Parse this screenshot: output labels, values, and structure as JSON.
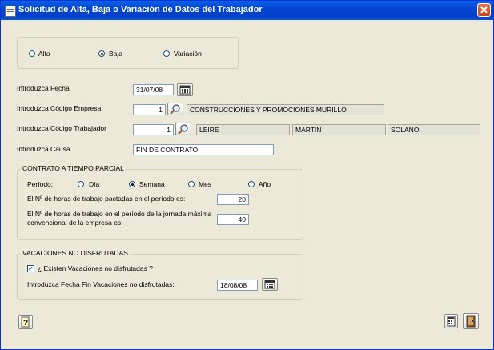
{
  "window": {
    "title": "Solicitud de Alta, Baja o Variación de Datos del Trabajador",
    "close_glyph": "✕"
  },
  "mode": {
    "options": [
      "Alta",
      "Baja",
      "Variación"
    ],
    "selected": "Baja"
  },
  "fecha": {
    "label": "Introduzca Fecha",
    "value": "31/07/08"
  },
  "empresa": {
    "label": "Introduzca Código Empresa",
    "code": "1",
    "name": "CONSTRUCCIONES Y PROMOCIONES MURILLO"
  },
  "trabajador": {
    "label": "Introduzca Código Trabajador",
    "code": "1",
    "nombre": "LEIRE",
    "apellido1": "MARTIN",
    "apellido2": "SOLANO"
  },
  "causa": {
    "label": "Introduzca Causa",
    "value": "FIN DE CONTRATO"
  },
  "tiempo_parcial": {
    "title": "CONTRATO A TIEMPO PARCIAL",
    "periodo_label": "Período:",
    "periodos": [
      "Día",
      "Semana",
      "Mes",
      "Año"
    ],
    "periodo_selected": "Semana",
    "horas_pactadas_label": "El Nº de horas de trabajo pactadas en el período es:",
    "horas_pactadas": "20",
    "horas_jornada_label_1": "El Nº de horas de trabajo en el período de la jornada máxima",
    "horas_jornada_label_2": "convencional de la empresa es:",
    "horas_jornada": "40"
  },
  "vacaciones": {
    "title": "VACACIONES NO DISFRUTADAS",
    "existen_label": "¿ Existen Vacaciones no disfrutadas ?",
    "existen_checked": true,
    "fecha_fin_label": "Introduzca Fecha Fin Vacaciones no disfrutadas:",
    "fecha_fin": "18/08/08"
  },
  "icons": {
    "calendar": "calendar-icon",
    "search": "magnifier-icon",
    "help": "help-icon",
    "calculator": "calculator-icon",
    "exit": "exit-door-icon"
  }
}
